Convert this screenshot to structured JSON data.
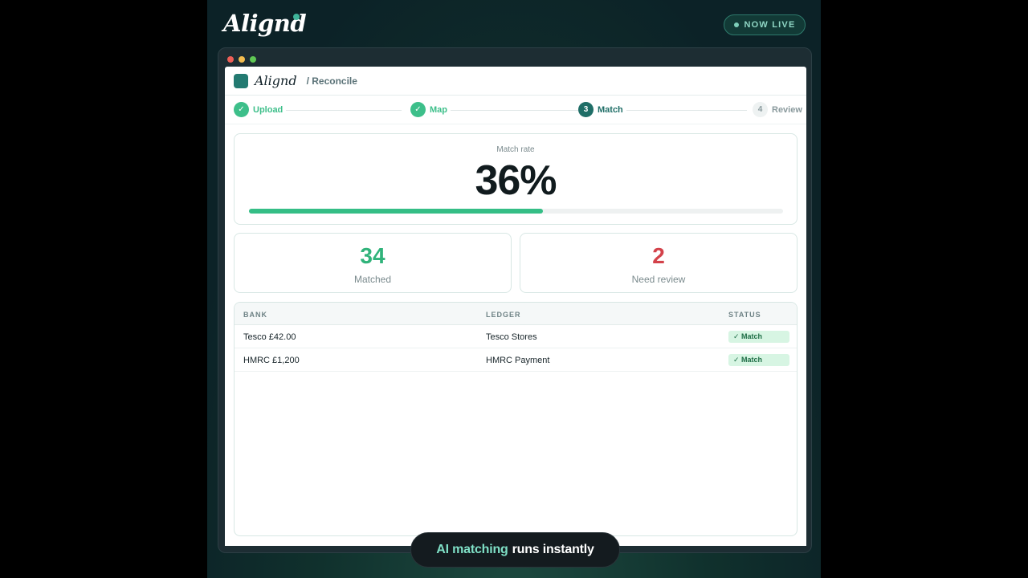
{
  "brand": {
    "name": "Alignd"
  },
  "badge": {
    "label": "NOW LIVE"
  },
  "app": {
    "name": "Alignd",
    "breadcrumb": "/ Reconcile"
  },
  "stepper": {
    "steps": [
      {
        "marker": "✓",
        "label": "Upload",
        "state": "done"
      },
      {
        "marker": "✓",
        "label": "Map",
        "state": "done"
      },
      {
        "marker": "3",
        "label": "Match",
        "state": "current"
      },
      {
        "marker": "4",
        "label": "Review",
        "state": "todo"
      }
    ]
  },
  "match_rate": {
    "label": "Match rate",
    "value": "36%",
    "progress_percent": 55
  },
  "stats": {
    "matched": {
      "value": "34",
      "label": "Matched"
    },
    "review": {
      "value": "2",
      "label": "Need review"
    }
  },
  "table": {
    "headers": [
      "BANK",
      "LEDGER",
      "STATUS"
    ],
    "rows": [
      {
        "bank": "Tesco £42.00",
        "ledger": "Tesco Stores",
        "status": "✓ Match"
      },
      {
        "bank": "HMRC £1,200",
        "ledger": "HMRC Payment",
        "status": "✓ Match"
      }
    ]
  },
  "caption": {
    "highlight": "AI matching",
    "rest": "runs instantly"
  },
  "colors": {
    "accent": "#1f6e67",
    "success": "#30b37a",
    "danger": "#d3424a"
  }
}
